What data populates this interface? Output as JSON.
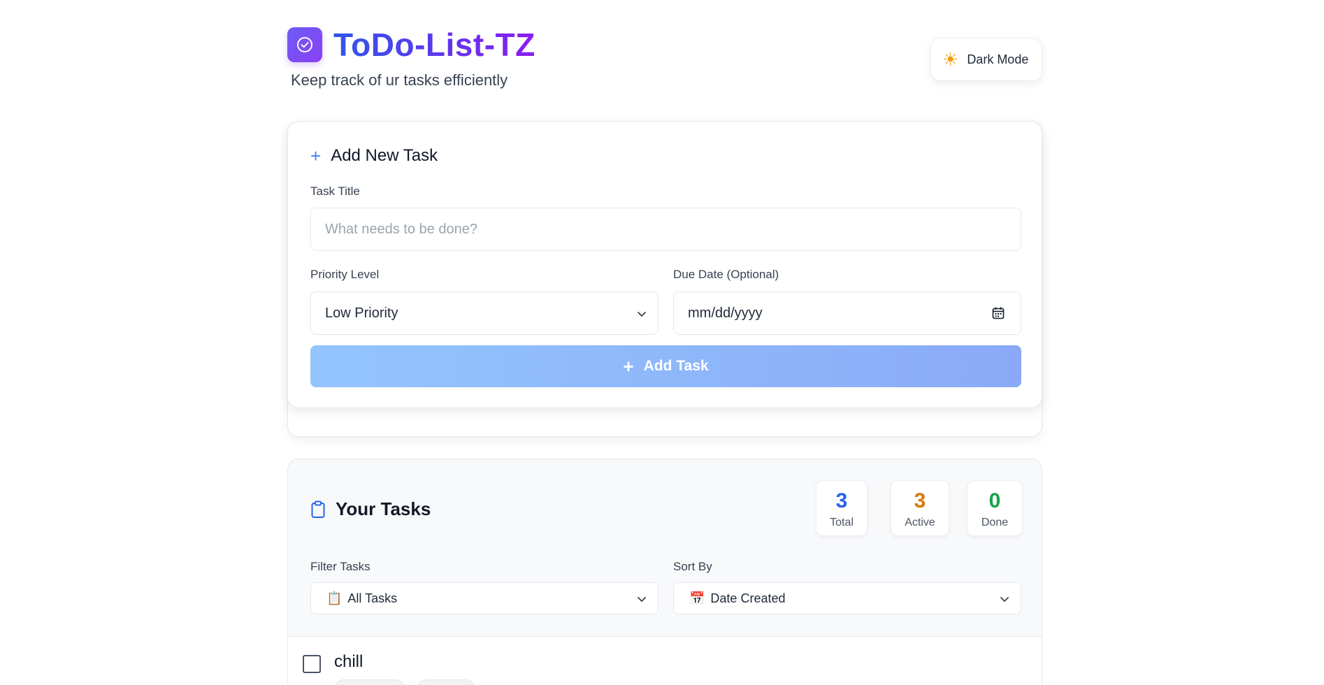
{
  "header": {
    "app_title": "ToDo-List-TZ",
    "subtitle": "Keep track of ur tasks efficiently",
    "mode_toggle_label": "Dark Mode",
    "mode_icon": "sun-icon"
  },
  "add_task": {
    "heading": "Add New Task",
    "title_label": "Task Title",
    "title_placeholder": "What needs to be done?",
    "title_value": "",
    "priority_label": "Priority Level",
    "priority_value": "Low Priority",
    "due_label": "Due Date (Optional)",
    "due_placeholder": "mm/dd/yyyy",
    "submit_label": "Add Task"
  },
  "tasks_panel": {
    "heading": "Your Tasks",
    "stats": {
      "total_value": "3",
      "total_label": "Total",
      "active_value": "3",
      "active_label": "Active",
      "done_value": "0",
      "done_label": "Done"
    },
    "filter_label": "Filter Tasks",
    "filter_value": "All Tasks",
    "filter_emoji": "📋",
    "sort_label": "Sort By",
    "sort_value": "Date Created",
    "sort_emoji": "📅",
    "items": [
      {
        "title": "chill",
        "completed": false
      }
    ]
  },
  "colors": {
    "accent_blue": "#3b82f6",
    "brand_purple": "#8b3ff2",
    "stat_total": "#2563eb",
    "stat_active": "#d97706",
    "stat_done": "#16a34a"
  }
}
